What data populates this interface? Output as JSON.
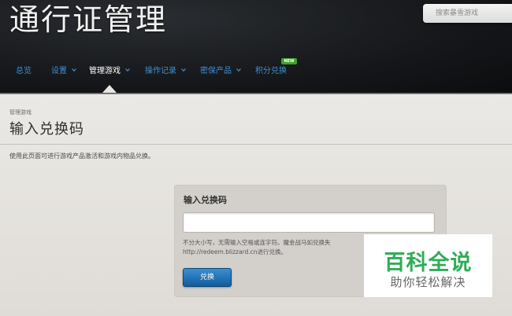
{
  "header": {
    "title": "通行证管理",
    "search_placeholder": "搜索暴雪游戏"
  },
  "nav": {
    "items": [
      {
        "label": "总览"
      },
      {
        "label": "设置"
      },
      {
        "label": "管理游戏"
      },
      {
        "label": "操作记录"
      },
      {
        "label": "密保产品"
      },
      {
        "label": "积分兑换"
      }
    ],
    "new_badge": "NEW"
  },
  "page": {
    "breadcrumb": "管理游戏",
    "title": "输入兑换码",
    "description": "使用此页面可进行游戏产品激活和游戏内物品兑换。"
  },
  "form": {
    "label": "输入兑换码",
    "code_value": "",
    "hint_line1": "不分大小写，无需输入空格或连字符。魔金战马如兑换失",
    "hint_line2": "http://redeem.blizzard.cn进行兑换。",
    "submit_label": "兑换"
  },
  "watermark": {
    "main": "百科全说",
    "sub": "助你轻松解决"
  },
  "colors": {
    "nav_link": "#3f8fd6",
    "button": "#1f6fb4",
    "badge": "#3ea32a",
    "watermark": "#2fad57"
  }
}
